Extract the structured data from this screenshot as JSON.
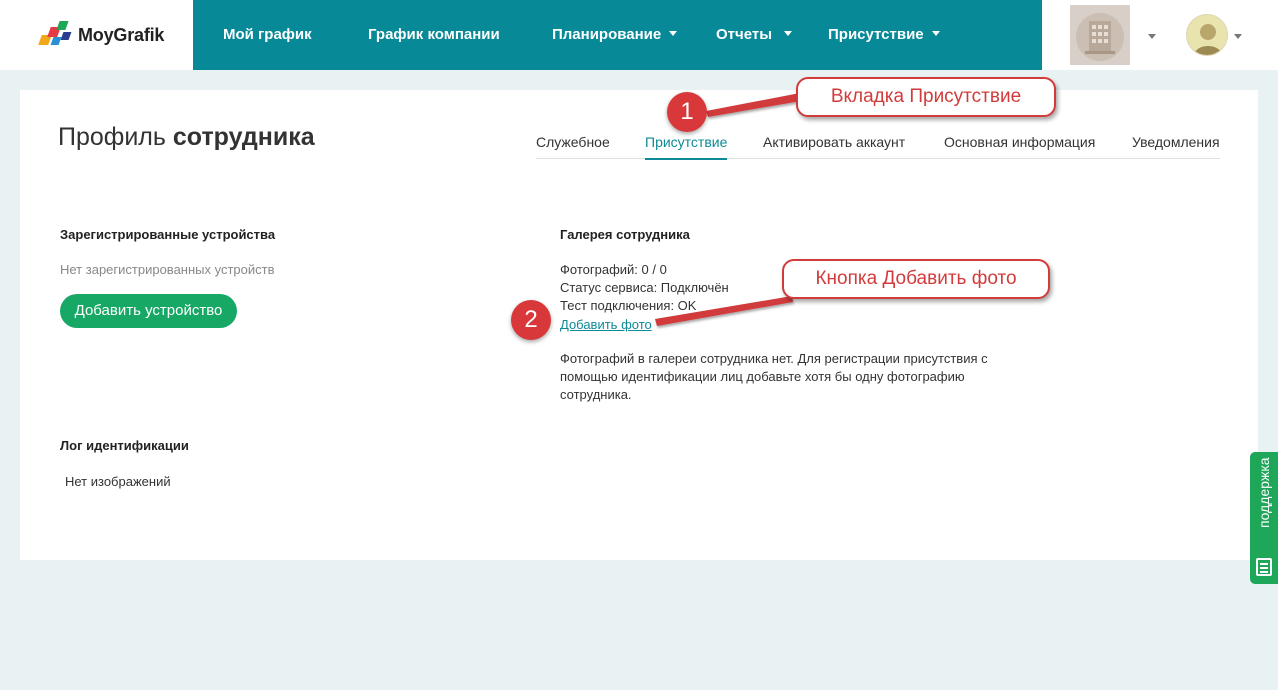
{
  "brand": {
    "name": "MoyGrafik"
  },
  "nav": {
    "items": [
      {
        "label": "Мой график",
        "dropdown": false
      },
      {
        "label": "График компании",
        "dropdown": false
      },
      {
        "label": "Планирование",
        "dropdown": true
      },
      {
        "label": "Отчеты",
        "dropdown": true
      },
      {
        "label": "Присутствие",
        "dropdown": true
      }
    ]
  },
  "page": {
    "title_light": "Профиль",
    "title_bold": "сотрудника"
  },
  "tabs": {
    "items": [
      {
        "label": "Служебное",
        "active": false
      },
      {
        "label": "Присутствие",
        "active": true
      },
      {
        "label": "Активировать аккаунт",
        "active": false
      },
      {
        "label": "Основная информация",
        "active": false
      },
      {
        "label": "Уведомления",
        "active": false
      }
    ]
  },
  "devices": {
    "title": "Зарегистрированные устройства",
    "empty_text": "Нет зарегистрированных устройств",
    "add_button": "Добавить устройство"
  },
  "gallery": {
    "title": "Галерея сотрудника",
    "photos": "Фотографий: 0 / 0",
    "service_status": "Статус сервиса: Подключён",
    "connection_test": "Тест подключения: OK",
    "add_photo": "Добавить фото",
    "note": "Фотографий в галереи сотрудника нет. Для регистрации присутствия с помощью идентификации лиц добавьте хотя бы одну фотографию сотрудника."
  },
  "log": {
    "title": "Лог идентификации",
    "empty_text": "Нет изображений"
  },
  "annotations": {
    "marker1": "1",
    "callout1": "Вкладка Присутствие",
    "marker2": "2",
    "callout2": "Кнопка Добавить фото"
  },
  "support": {
    "label": "поддержка"
  },
  "colors": {
    "nav_bg": "#078998",
    "accent": "#0c8a97",
    "button_green": "#18a865",
    "annotation_red": "#d23b3b",
    "support_green": "#1ea659",
    "page_bg": "#e9f2f3"
  }
}
